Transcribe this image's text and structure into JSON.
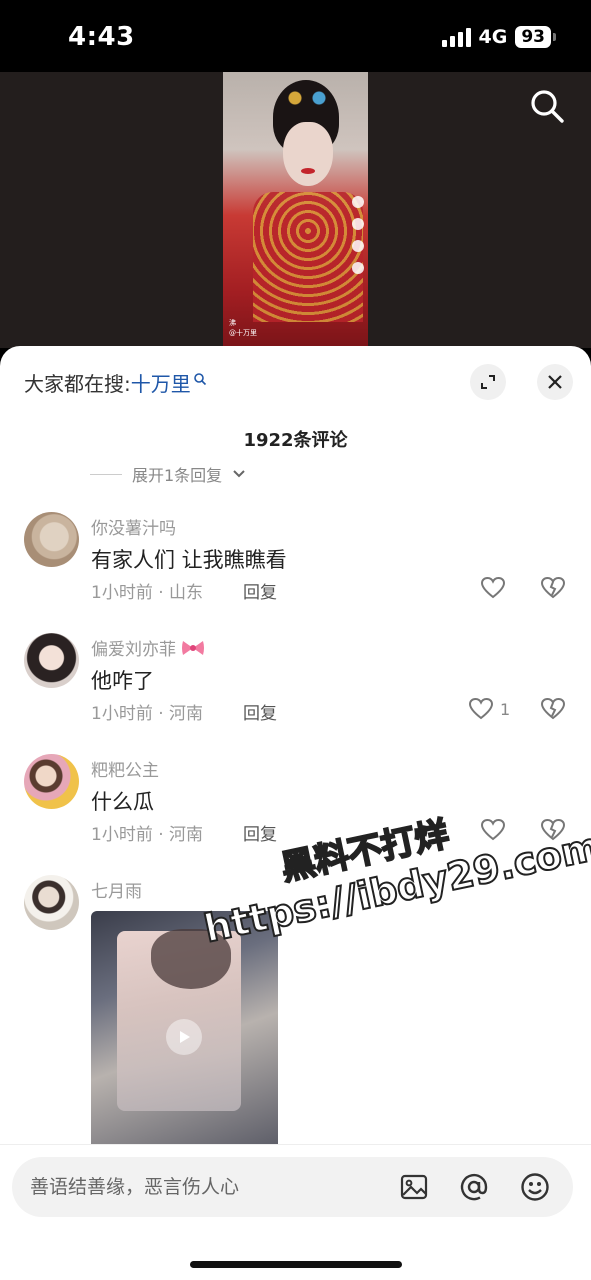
{
  "status": {
    "time": "4:43",
    "network": "4G",
    "battery": "93"
  },
  "video": {
    "caption_line1": "沸",
    "caption_line2": "@十万里"
  },
  "sheet": {
    "search_prefix": "大家都在搜:",
    "search_keyword": "十万里",
    "comment_count": "1922条评论",
    "expand_replies": "展开1条回复"
  },
  "comments": [
    {
      "username": "你没薯汁吗",
      "text": "有家人们 让我瞧瞧看",
      "meta": "1小时前 · 山东",
      "reply": "回复",
      "likes": ""
    },
    {
      "username": "偏爱刘亦菲",
      "text": "他咋了",
      "meta": "1小时前 · 河南",
      "reply": "回复",
      "likes": "1"
    },
    {
      "username": "粑粑公主",
      "text": "什么瓜",
      "meta": "1小时前 · 河南",
      "reply": "回复",
      "likes": ""
    },
    {
      "username": "七月雨",
      "text": "",
      "meta": "",
      "reply": "",
      "likes": ""
    }
  ],
  "watermark": {
    "line1": "黑料不打烊",
    "line2": "https://ibdy29.com"
  },
  "input": {
    "placeholder": "善语结善缘，恶言伤人心"
  },
  "colors": {
    "keyword": "#1f57a8",
    "sheet_bg": "#ffffff",
    "video_bg": "#231e1d"
  }
}
